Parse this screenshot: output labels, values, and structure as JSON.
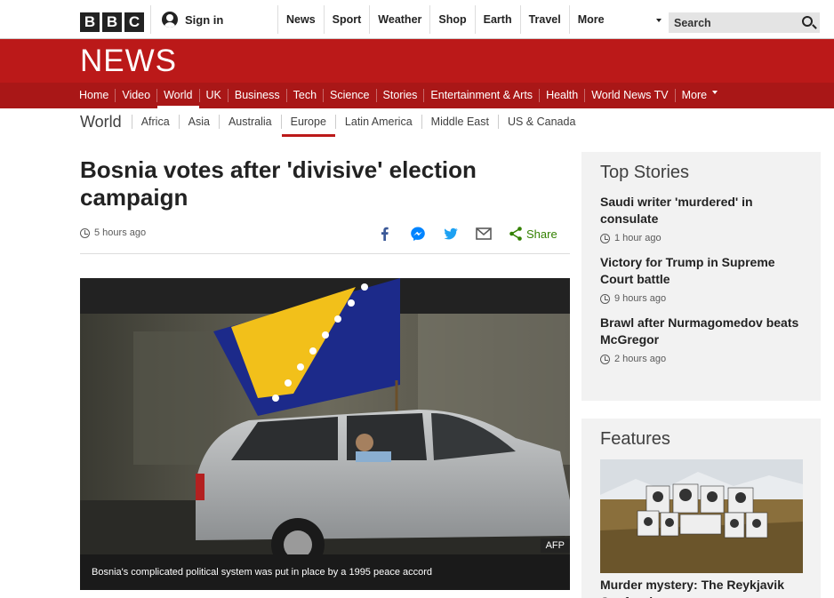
{
  "brand": {
    "logo_letters": [
      "B",
      "B",
      "C"
    ],
    "section_logo": "NEWS",
    "accent": "#bb1919"
  },
  "header": {
    "signin_label": "Sign in",
    "nav": [
      "News",
      "Sport",
      "Weather",
      "Shop",
      "Earth",
      "Travel",
      "More"
    ],
    "search_placeholder": "Search"
  },
  "news_nav": {
    "items": [
      "Home",
      "Video",
      "World",
      "UK",
      "Business",
      "Tech",
      "Science",
      "Stories",
      "Entertainment & Arts",
      "Health",
      "World News TV",
      "More"
    ],
    "active": "World"
  },
  "sub_nav": {
    "section": "World",
    "items": [
      "Africa",
      "Asia",
      "Australia",
      "Europe",
      "Latin America",
      "Middle East",
      "US & Canada"
    ],
    "active": "Europe"
  },
  "article": {
    "headline": "Bosnia votes after 'divisive' election campaign",
    "timestamp": "5 hours ago",
    "share_label": "Share",
    "image_credit": "AFP",
    "image_caption": "Bosnia's complicated political system was put in place by a 1995 peace accord"
  },
  "top_stories": {
    "heading": "Top Stories",
    "items": [
      {
        "title": "Saudi writer 'murdered' in consulate",
        "time": "1 hour ago"
      },
      {
        "title": "Victory for Trump in Supreme Court battle",
        "time": "9 hours ago"
      },
      {
        "title": "Brawl after Nurmagomedov beats McGregor",
        "time": "2 hours ago"
      }
    ]
  },
  "features": {
    "heading": "Features",
    "items": [
      {
        "title": "Murder mystery: The Reykjavik Confessions"
      }
    ]
  }
}
